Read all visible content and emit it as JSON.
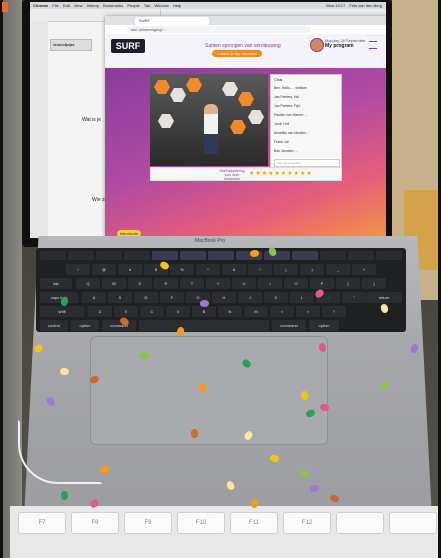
{
  "screen": {
    "menubar": {
      "app": "Chrome",
      "items": [
        "File",
        "Edit",
        "View",
        "History",
        "Bookmarks",
        "People",
        "Tab",
        "Window",
        "Help"
      ],
      "clock": "Mon 13:17",
      "user": "Frits van den Berg"
    },
    "left_app": {
      "doc_tab": "sessionlijstjes",
      "text_1": "Wat is je",
      "text_2": "Wie zijn"
    },
    "browser": {
      "tab_label": "SURF",
      "url": "surf.nl/vereniging/...",
      "site": {
        "logo": "SURF",
        "tagline": "Samen sprongen van vernieuwing",
        "back_button": "< Back to the overview",
        "date": "Monday 28 September",
        "program_label": "My program",
        "chat": {
          "title": "Chat",
          "messages": [
            "Ben: Hallo... - welkom",
            "Jan Peeters: Hoi",
            "Jan Peeters: Fijn!",
            "Paulien van Manen: ...",
            "Jordi: Hoi!",
            "Annelies van Muiden: ...",
            "Frank: Ja!",
            "Bas Janssen: ..."
          ],
          "input_placeholder": "Typ hier je bericht"
        },
        "reaction_label": "Geef waardering voor deze livestream",
        "stars": "★★★★★★★★★★",
        "intro_button": "Introductie"
      }
    }
  },
  "laptop": {
    "brand": "MacBook Pro",
    "keys": {
      "row1": [
        "!",
        "@",
        "#",
        "$",
        "%",
        "^",
        "&",
        "*",
        "(",
        ")",
        "_",
        "+"
      ],
      "row2": [
        "Q",
        "W",
        "E",
        "R",
        "T",
        "Y",
        "U",
        "I",
        "O",
        "P",
        "{",
        "}"
      ],
      "row3": [
        "A",
        "S",
        "D",
        "F",
        "G",
        "H",
        "J",
        "K",
        "L",
        ":",
        "\""
      ],
      "row4": [
        "Z",
        "X",
        "C",
        "V",
        "B",
        "N",
        "M",
        "<",
        ">",
        "?"
      ],
      "row5": [
        "control",
        "option",
        "command",
        "",
        "command",
        "option"
      ],
      "modifiers": {
        "tab": "tab",
        "caps": "caps lock",
        "shift": "shift",
        "enter": "return"
      }
    }
  },
  "external_keyboard": {
    "keys": [
      "F7",
      "F8",
      "F9",
      "F10",
      "F11",
      "F12",
      "",
      ""
    ]
  },
  "colors": {
    "surf_purple": "#7d3e96",
    "surf_orange": "#f28b1f",
    "confetti": [
      "#f59b1a",
      "#f2c40f",
      "#8cc152",
      "#2f9e5a",
      "#d95d8b",
      "#9a7ad1",
      "#c96a2f",
      "#f7e7a0"
    ]
  }
}
